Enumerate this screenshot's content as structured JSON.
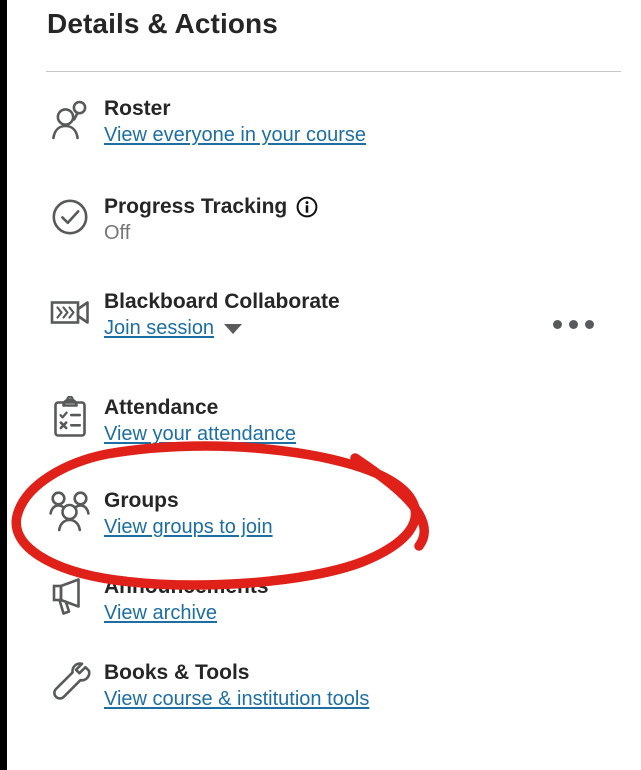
{
  "panel": {
    "title": "Details & Actions",
    "accent_link_color": "#1d6fa3",
    "title_color": "#262626",
    "muted_color": "#767676",
    "annotation_color": "#e0211a"
  },
  "items": [
    {
      "id": "roster",
      "icon": "two-people-icon",
      "title": "Roster",
      "link": "View everyone in your course"
    },
    {
      "id": "progress-tracking",
      "icon": "check-circle-icon",
      "title": "Progress Tracking",
      "info_icon": "info-circle-icon",
      "status": "Off"
    },
    {
      "id": "blackboard-collaborate",
      "icon": "video-camera-icon",
      "title": "Blackboard Collaborate",
      "link": "Join session",
      "caret_icon": "chevron-down-icon",
      "overflow_icon": "more-options-icon"
    },
    {
      "id": "attendance",
      "icon": "clipboard-check-icon",
      "title": "Attendance",
      "link": "View your attendance"
    },
    {
      "id": "groups",
      "icon": "three-people-icon",
      "title": "Groups",
      "link": "View groups to join"
    },
    {
      "id": "announcements",
      "icon": "megaphone-icon",
      "title": "Announcements",
      "link": "View archive"
    },
    {
      "id": "books-and-tools",
      "icon": "wrench-icon",
      "title": "Books & Tools",
      "link": "View course & institution tools"
    }
  ],
  "annotation": {
    "shape": "red-ellipse-highlight",
    "targets": "groups"
  }
}
